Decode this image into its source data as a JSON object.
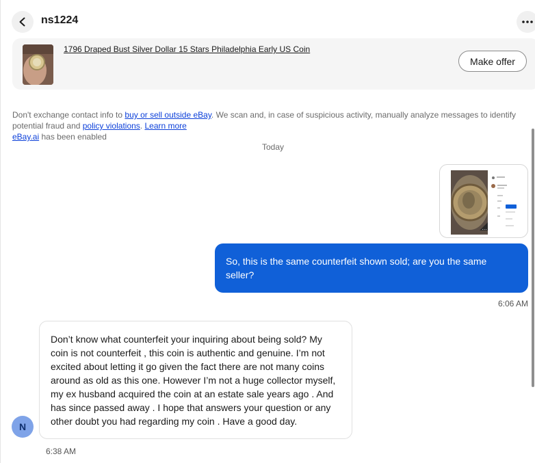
{
  "header": {
    "username": "ns1224",
    "back_icon": "chevron-left-icon",
    "more_icon": "more-horizontal-icon"
  },
  "listing": {
    "title": "1796 Draped Bust Silver Dollar 15 Stars Philadelphia Early US Coin",
    "make_offer_label": "Make offer"
  },
  "notice": {
    "prefix": "Don't exchange contact info to ",
    "link1": "buy or sell outside eBay",
    "middle": ". We scan and, in case of suspicious activity, manually analyze messages to identify potential fraud and ",
    "link2": "policy violations",
    "sep": ". ",
    "link3": "Learn more",
    "ai_link": "eBay.ai",
    "ai_suffix": " has been enabled"
  },
  "day_separator": "Today",
  "messages": [
    {
      "direction": "outgoing",
      "attachment": "image",
      "text": "So, this is the same counterfeit shown sold; are you the same seller?",
      "time": "6:06 AM"
    },
    {
      "direction": "incoming",
      "avatar_initial": "N",
      "text": "Don’t know what counterfeit your inquiring about being sold? My coin is not counterfeit , this coin is authentic and genuine. I’m not excited about letting it go given the fact there are not many coins around as old as this one. However I’m not a huge collector myself, my ex husband acquired the coin at an estate sale years ago . And has since passed away . I hope that answers your question or any other doubt you had regarding my coin . Have a good day.",
      "time": "6:38 AM"
    }
  ],
  "colors": {
    "outgoing_bubble": "#1060d8",
    "link": "#0b3fd9",
    "avatar": "#7fa3e8"
  }
}
